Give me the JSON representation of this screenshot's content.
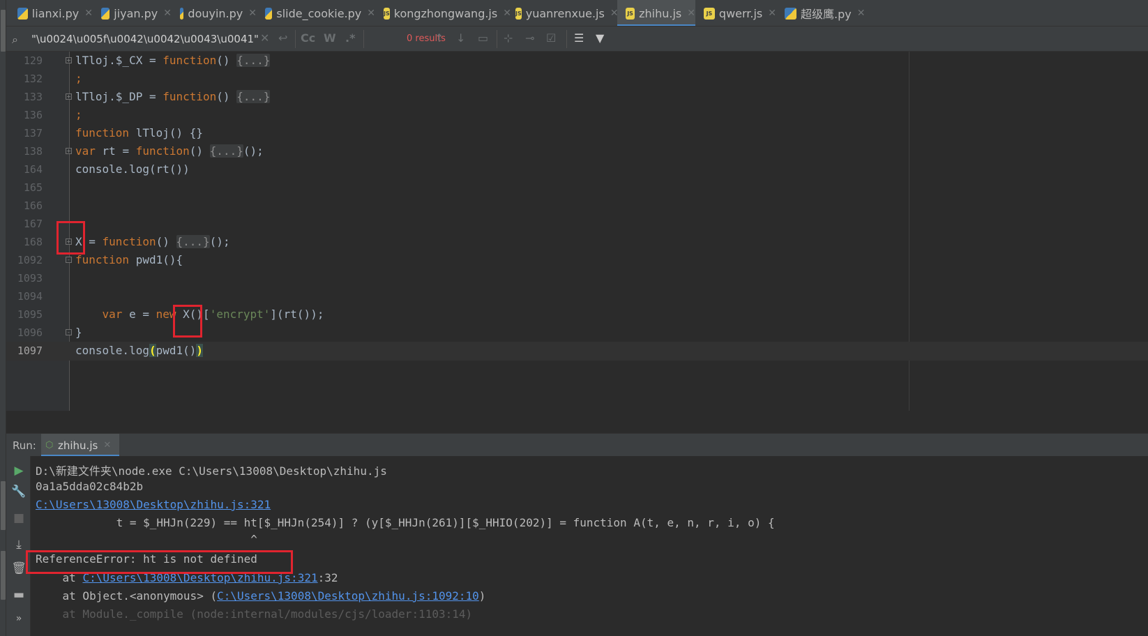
{
  "tabs": [
    {
      "label": "lianxi.py",
      "kind": "py",
      "active": false
    },
    {
      "label": "jiyan.py",
      "kind": "py",
      "active": false
    },
    {
      "label": "douyin.py",
      "kind": "py",
      "active": false
    },
    {
      "label": "slide_cookie.py",
      "kind": "py",
      "active": false
    },
    {
      "label": "kongzhongwang.js",
      "kind": "js",
      "active": false
    },
    {
      "label": "yuanrenxue.js",
      "kind": "js",
      "active": false
    },
    {
      "label": "zhihu.js",
      "kind": "js",
      "active": true
    },
    {
      "label": "qwerr.js",
      "kind": "js",
      "active": false
    },
    {
      "label": "超级鹰.py",
      "kind": "py",
      "active": false
    }
  ],
  "search": {
    "query": "\"\\u0024\\u005f\\u0042\\u0042\\u0043\\u0041\"",
    "results": "0 results",
    "toggle_case": "Cc",
    "toggle_words": "W",
    "toggle_regex": ".*"
  },
  "editor": {
    "lines": [
      {
        "n": "129",
        "fold": "+"
      },
      {
        "n": "132",
        "fold": ""
      },
      {
        "n": "133",
        "fold": "+"
      },
      {
        "n": "136",
        "fold": ""
      },
      {
        "n": "137",
        "fold": ""
      },
      {
        "n": "138",
        "fold": "+"
      },
      {
        "n": "164",
        "fold": ""
      },
      {
        "n": "165",
        "fold": ""
      },
      {
        "n": "166",
        "fold": ""
      },
      {
        "n": "167",
        "fold": ""
      },
      {
        "n": "168",
        "fold": "+"
      },
      {
        "n": "1092",
        "fold": "-"
      },
      {
        "n": "1093",
        "fold": ""
      },
      {
        "n": "1094",
        "fold": ""
      },
      {
        "n": "1095",
        "fold": ""
      },
      {
        "n": "1096",
        "fold": "-"
      },
      {
        "n": "1097",
        "fold": "",
        "current": true
      }
    ],
    "code": {
      "l129_a": "lTloj.$_CX = ",
      "l129_kw": "function",
      "l129_b": "() ",
      "l129_ph": "{...}",
      "l132": ";",
      "l133_a": "lTloj.$_DP = ",
      "l133_kw": "function",
      "l133_b": "() ",
      "l133_ph": "{...}",
      "l136": ";",
      "l137_kw": "function",
      "l137_b": " lTloj() {}",
      "l138_kw": "var",
      "l138_a": " rt = ",
      "l138_kw2": "function",
      "l138_b": "() ",
      "l138_ph": "{...}",
      "l138_c": "();",
      "l164": "console.log(rt())",
      "l168_a": "X = ",
      "l168_kw": "function",
      "l168_b": "() ",
      "l168_ph": "{...}",
      "l168_c": "();",
      "l1092_kw": "function",
      "l1092_b": " pwd1(){",
      "l1095_indent": "    ",
      "l1095_kw": "var",
      "l1095_a": " e = ",
      "l1095_kw2": "new",
      "l1095_b": " X()[",
      "l1095_str": "'encrypt'",
      "l1095_c": "](rt());",
      "l1096": "}",
      "l1097_a": "console.log",
      "l1097_p1": "(",
      "l1097_b": "pwd1()",
      "l1097_p2": ")"
    }
  },
  "run": {
    "label": "Run:",
    "tab": "zhihu.js",
    "output": {
      "cmd": "D:\\新建文件夹\\node.exe C:\\Users\\13008\\Desktop\\zhihu.js",
      "hash": "0a1a5dda02c84b2b",
      "err_link": "C:\\Users\\13008\\Desktop\\zhihu.js:321",
      "src_line": "            t = $_HHJn(229) == ht[$_HHJn(254)] ? (y[$_HHJn(261)][$_HHIO(202)] = function A(t, e, n, r, i, o) {",
      "caret": "                                ^",
      "error": "ReferenceError: ht is not defined",
      "at1_pre": "    at ",
      "at1_link": "C:\\Users\\13008\\Desktop\\zhihu.js:321",
      "at1_post": ":32",
      "at2_pre": "    at Object.<anonymous> (",
      "at2_link": "C:\\Users\\13008\\Desktop\\zhihu.js:1092:10",
      "at2_post": ")",
      "at3": "    at Module._compile (node:internal/modules/cjs/loader:1103:14)"
    }
  },
  "colors": {
    "keyword": "#cc7832",
    "string": "#6a8759",
    "link": "#5394ec",
    "annotation": "#e0242f",
    "accent": "#4a88c7"
  },
  "icons": {
    "py_file": "python-file-icon",
    "js_file": "javascript-file-icon",
    "close": "close-icon",
    "search": "search-icon",
    "run": "run-icon",
    "wrench": "wrench-icon",
    "stop": "stop-icon",
    "scroll_end": "scroll-to-end-icon",
    "trash": "trash-icon",
    "layout": "layout-icon",
    "more": "more-icon"
  }
}
